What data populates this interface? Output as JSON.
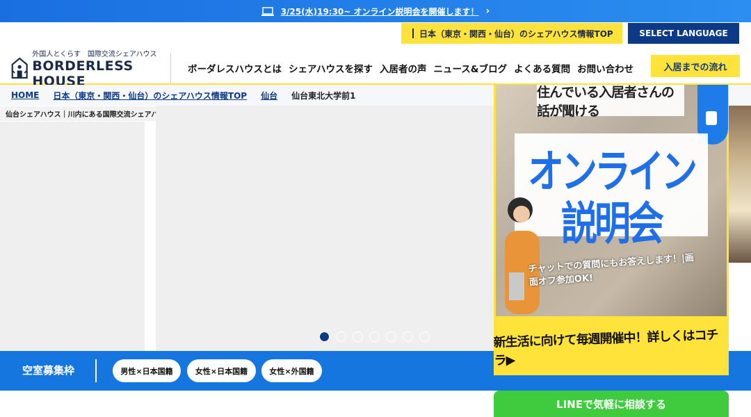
{
  "announcement": {
    "icon": "laptop-icon",
    "text": "3/25(水)19:30~ オンライン説明会を開催します！",
    "chevron": "›"
  },
  "subnav": {
    "japan_top": "日本（東京・関西・仙台）のシェアハウス情報TOP",
    "language": "SELECT LANGUAGE"
  },
  "logo": {
    "tagline": "外国人とくらす　国際交流シェアハウス",
    "name": "BORDERLESS HOUSE"
  },
  "nav": {
    "items": [
      "ボーダレスハウスとは",
      "シェアハウスを探す",
      "入居者の声",
      "ニュース&ブログ",
      "よくある質問",
      "お問い合わせ"
    ],
    "flow_button": "入居までの流れ"
  },
  "breadcrumb": {
    "items": [
      "HOME",
      "日本（東京・関西・仙台）のシェアハウス情報TOP",
      "仙台"
    ],
    "current": "仙台東北大学前1"
  },
  "property_tagline": "仙台シェアハウス｜川内にある国際交流シェアハウス｜仙台市地下鉄東西線沿いの個室/ルームシェア",
  "gallery": {
    "dot_count": 7,
    "active_dot": 0
  },
  "vacancy": {
    "title": "空室募集枠",
    "filters": [
      "男性×日本国籍",
      "女性×日本国籍",
      "女性×外国籍"
    ]
  },
  "banner": {
    "header": "住んでいる入居者さんの話が聞ける",
    "main": "オンライン説明会",
    "sub": "チャットでの質問にもお答えします！|画面オフ参加OK!",
    "bottom": "新生活に向けて毎週開催中！詳しくはコチラ▶"
  },
  "line_button": "LINEで気軽に相談する",
  "colors": {
    "brand_blue": "#0c3a87",
    "accent_yellow": "#ffe23a",
    "bar_blue": "#1576e0",
    "line_green": "#3ecb3e"
  }
}
